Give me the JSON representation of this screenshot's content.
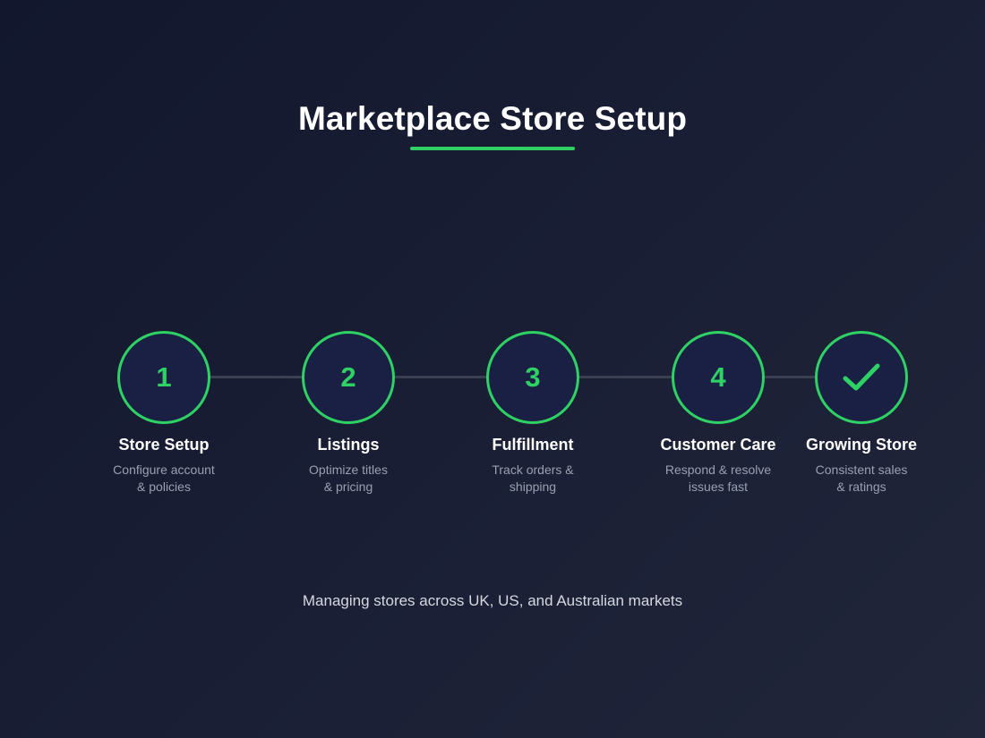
{
  "title": "Marketplace Store Setup",
  "colors": {
    "accent": "#2fd164",
    "connector": "#3a3f52",
    "circle_fill": "#1a2043"
  },
  "steps": [
    {
      "marker": "1",
      "title": "Store Setup",
      "desc_line1": "Configure account",
      "desc_line2": "& policies"
    },
    {
      "marker": "2",
      "title": "Listings",
      "desc_line1": "Optimize titles",
      "desc_line2": "& pricing"
    },
    {
      "marker": "3",
      "title": "Fulfillment",
      "desc_line1": "Track orders &",
      "desc_line2": "shipping"
    },
    {
      "marker": "4",
      "title": "Customer Care",
      "desc_line1": "Respond & resolve",
      "desc_line2": "issues fast"
    },
    {
      "marker_icon": "checkmark-icon",
      "title": "Growing Store",
      "desc_line1": "Consistent sales",
      "desc_line2": "& ratings"
    }
  ],
  "footer": "Managing stores across UK, US, and Australian markets"
}
